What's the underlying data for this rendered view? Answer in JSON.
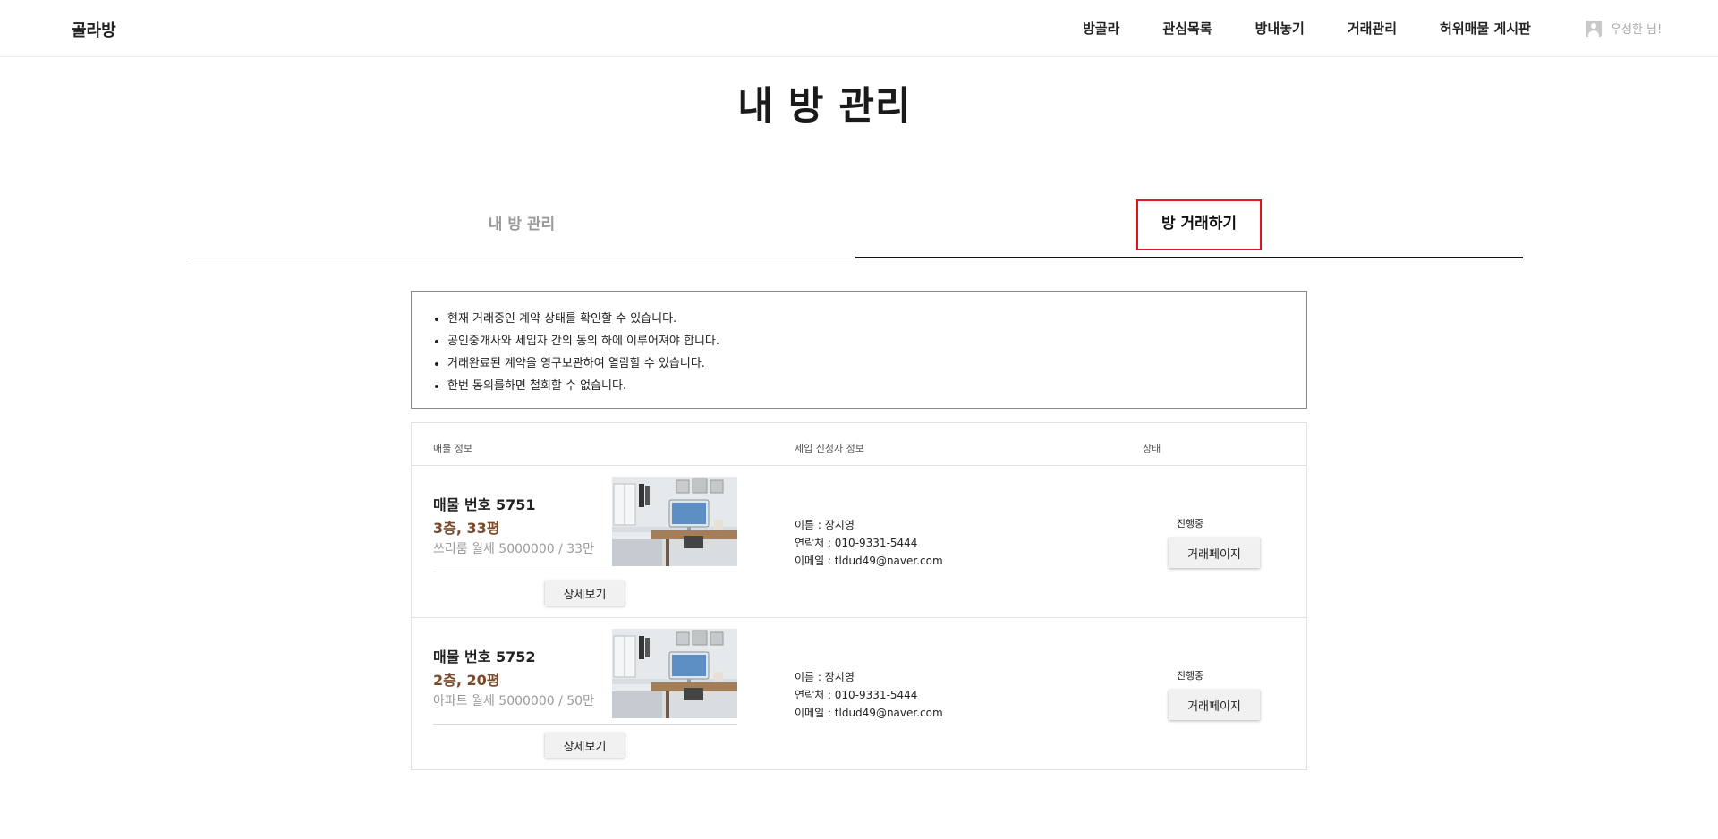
{
  "header": {
    "logo": "골라방",
    "nav": [
      "방골라",
      "관심목록",
      "방내놓기",
      "거래관리",
      "허위매물 게시판"
    ],
    "user": "우성환 님!"
  },
  "page_title": "내 방 관리",
  "tabs": [
    {
      "label": "내 방 관리",
      "active": false
    },
    {
      "label": "방 거래하기",
      "active": true
    }
  ],
  "notice": [
    "현재 거래중인 계약 상태를 확인할 수 있습니다.",
    "공인중개사와 세입자 간의 동의 하에 이루어져야 합니다.",
    "거래완료된 계약을 영구보관하여 열람할 수 있습니다.",
    "한번 동의를하면 철회할 수 없습니다."
  ],
  "table": {
    "headers": [
      "매물 정보",
      "세입 신청자 정보",
      "상태"
    ],
    "rows": [
      {
        "property_no": "매물 번호 5751",
        "floor_size": "3층, 33평",
        "price": "쓰리룸 월세 5000000 / 33만",
        "detail_btn": "상세보기",
        "name": "이름 : 장시영",
        "phone": "연락처 : 010-9331-5444",
        "email": "이메일 : tldud49@naver.com",
        "status": "진행중",
        "deal_btn": "거래페이지"
      },
      {
        "property_no": "매물 번호 5752",
        "floor_size": "2층, 20평",
        "price": "아파트 월세 5000000 / 50만",
        "detail_btn": "상세보기",
        "name": "이름 : 장시영",
        "phone": "연락처 : 010-9331-5444",
        "email": "이메일 : tldud49@naver.com",
        "status": "진행중",
        "deal_btn": "거래페이지"
      }
    ]
  },
  "colors": {
    "accent_red": "#e0141e",
    "price_brown": "#7a4a2a",
    "muted_gray": "#9a9a9a"
  }
}
